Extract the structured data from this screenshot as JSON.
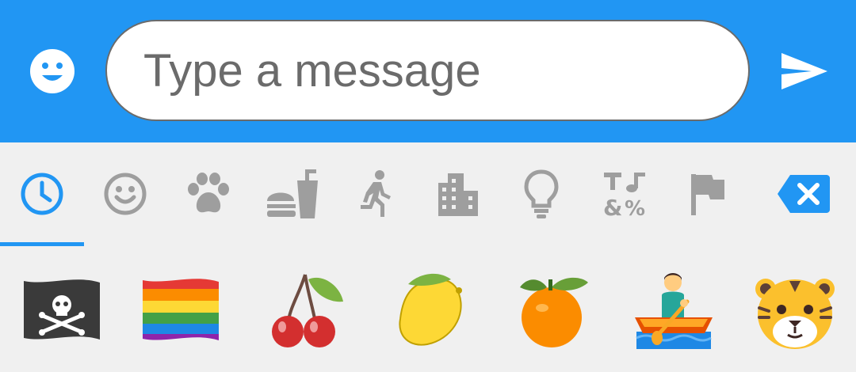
{
  "composer": {
    "placeholder": "Type a message",
    "value": "",
    "emoji_button_icon": "smiley-icon",
    "send_button_icon": "send-icon"
  },
  "colors": {
    "accent": "#2196f3",
    "tab_icon_gray": "#9e9e9e",
    "panel_background": "#f0f0f0"
  },
  "emoji_categories": [
    {
      "id": "recent",
      "icon": "clock-icon",
      "selected": true
    },
    {
      "id": "smileys",
      "icon": "smiley-icon",
      "selected": false
    },
    {
      "id": "animals",
      "icon": "paw-icon",
      "selected": false
    },
    {
      "id": "food",
      "icon": "food-drink-icon",
      "selected": false
    },
    {
      "id": "activities",
      "icon": "running-person-icon",
      "selected": false
    },
    {
      "id": "travel",
      "icon": "city-icon",
      "selected": false
    },
    {
      "id": "objects",
      "icon": "lightbulb-icon",
      "selected": false
    },
    {
      "id": "symbols",
      "icon": "symbols-icon",
      "selected": false
    },
    {
      "id": "flags",
      "icon": "flag-icon",
      "selected": false
    }
  ],
  "backspace_icon": "backspace-icon",
  "recent_emojis": [
    {
      "name": "pirate-flag"
    },
    {
      "name": "rainbow-flag"
    },
    {
      "name": "cherries"
    },
    {
      "name": "lemon"
    },
    {
      "name": "tangerine"
    },
    {
      "name": "person-rowing-boat"
    },
    {
      "name": "tiger-face"
    }
  ]
}
